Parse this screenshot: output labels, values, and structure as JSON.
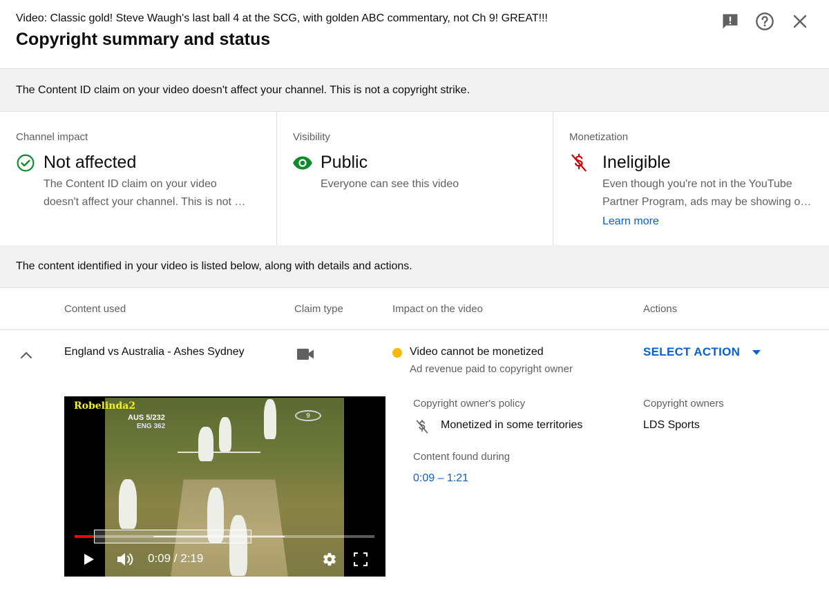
{
  "header": {
    "video_title": "Video: Classic gold! Steve Waugh's last ball 4 at the SCG, with golden ABC commentary, not Ch 9! GREAT!!!",
    "dialog_title": "Copyright summary and status",
    "icons": [
      "feedback-icon",
      "help-icon",
      "close-icon"
    ]
  },
  "notice_banner": "The Content ID claim on your video doesn't affect your channel. This is not a copyright strike.",
  "status_cards": {
    "channel_impact": {
      "label": "Channel impact",
      "value": "Not affected",
      "desc_line1": "The Content ID claim on your video",
      "desc_line2": "doesn't affect your channel. This is not …",
      "icon": "check-circle-icon",
      "color": "#0f8a2c"
    },
    "visibility": {
      "label": "Visibility",
      "value": "Public",
      "desc_line1": "Everyone can see this video",
      "icon": "eye-icon",
      "color": "#0f8a2c"
    },
    "monetization": {
      "label": "Monetization",
      "value": "Ineligible",
      "desc_line1": "Even though you're not in the YouTube",
      "desc_line2": "Partner Program, ads may be showing o…",
      "link": "Learn more",
      "icon": "no-money-icon",
      "color": "#cc0000"
    }
  },
  "content_banner": "The content identified in your video is listed below, along with details and actions.",
  "table": {
    "headers": {
      "content_used": "Content used",
      "claim_type": "Claim type",
      "impact": "Impact on the video",
      "actions": "Actions"
    },
    "row": {
      "content": "England vs Australia - Ashes Sydney",
      "claim_type_icon": "video-camera-icon",
      "impact_title": "Video cannot be monetized",
      "impact_sub": "Ad revenue paid to copyright owner",
      "impact_dot_color": "#f9b90a",
      "action_label": "SELECT ACTION"
    }
  },
  "player": {
    "watermark": "Robelinda2",
    "score_line1": "AUS 5/232",
    "score_line2": "ENG 362",
    "channel_logo": "9",
    "time": "0:09 / 2:19",
    "progress_fraction": 0.065,
    "claim_start_fraction": 0.065,
    "claim_end_fraction": 0.59
  },
  "details": {
    "policy_label": "Copyright owner's policy",
    "policy_value": "Monetized in some territories",
    "owners_label": "Copyright owners",
    "owners_value": "LDS Sports",
    "found_label": "Content found during",
    "found_value": "0:09 – 1:21"
  },
  "colors": {
    "link_blue": "#065fd4",
    "banner_bg": "#f2f2f2",
    "secondary_text": "#606060"
  }
}
